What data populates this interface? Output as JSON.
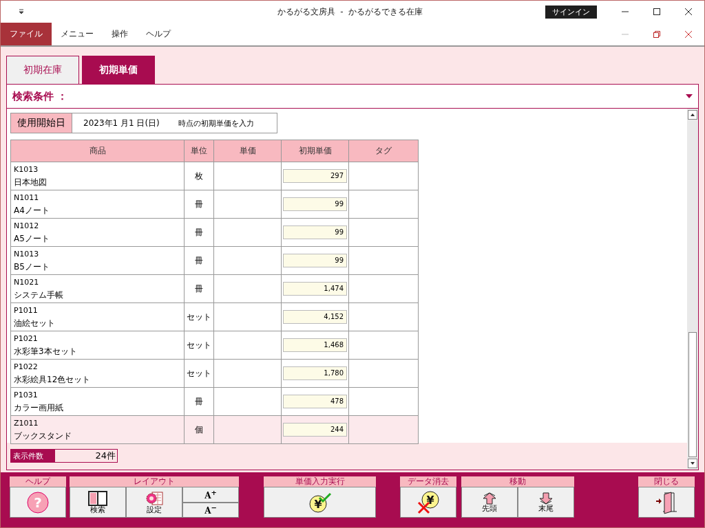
{
  "window": {
    "title": "かるがる文房具  -  かるがるできる在庫",
    "sign_in": "サインイン"
  },
  "menu": [
    {
      "label": "ファイル",
      "selected": true
    },
    {
      "label": "メニュー",
      "selected": false
    },
    {
      "label": "操作",
      "selected": false
    },
    {
      "label": "ヘルプ",
      "selected": false
    }
  ],
  "tabs": [
    {
      "label": "初期在庫",
      "selected": false
    },
    {
      "label": "初期単価",
      "selected": true
    }
  ],
  "search_conditions": {
    "label": "検索条件 ："
  },
  "start_date": {
    "label": "使用開始日",
    "value": "2023年1 月1 日(日)",
    "note": "時点の初期単価を入力"
  },
  "table": {
    "columns": [
      "商品",
      "単位",
      "単価",
      "初期単価",
      "タグ"
    ],
    "rows": [
      {
        "code": "K1013",
        "name": "日本地図",
        "unit": "枚",
        "initial_price": "297",
        "selected": false
      },
      {
        "code": "N1011",
        "name": "A4ノート",
        "unit": "冊",
        "initial_price": "99",
        "selected": false
      },
      {
        "code": "N1012",
        "name": "A5ノート",
        "unit": "冊",
        "initial_price": "99",
        "selected": false
      },
      {
        "code": "N1013",
        "name": "B5ノート",
        "unit": "冊",
        "initial_price": "99",
        "selected": false
      },
      {
        "code": "N1021",
        "name": "システム手帳",
        "unit": "冊",
        "initial_price": "1,474",
        "selected": false
      },
      {
        "code": "P1011",
        "name": "油絵セット",
        "unit": "セット",
        "initial_price": "4,152",
        "selected": false
      },
      {
        "code": "P1021",
        "name": "水彩筆3本セット",
        "unit": "セット",
        "initial_price": "1,468",
        "selected": false
      },
      {
        "code": "P1022",
        "name": "水彩絵具12色セット",
        "unit": "セット",
        "initial_price": "1,780",
        "selected": false
      },
      {
        "code": "P1031",
        "name": "カラー画用紙",
        "unit": "冊",
        "initial_price": "478",
        "selected": false
      },
      {
        "code": "Z1011",
        "name": "ブックスタンド",
        "unit": "個",
        "initial_price": "244",
        "selected": true
      }
    ]
  },
  "record_count": {
    "label": "表示件数",
    "value": "24件"
  },
  "toolbar": [
    {
      "label": "ヘルプ",
      "buttons": [
        {
          "kind": "help",
          "glyph": "?"
        }
      ]
    },
    {
      "label": "レイアウト",
      "buttons": [
        {
          "kind": "search",
          "label": "検索"
        },
        {
          "kind": "settings",
          "label": "設定"
        },
        {
          "kind": "font",
          "sizes": [
            "A$^{+}$",
            "A$^{−}$"
          ]
        }
      ]
    },
    {
      "label": "単価入力実行",
      "buttons": [
        {
          "kind": "execute",
          "glyph": "¥"
        }
      ]
    },
    {
      "label": "データ消去",
      "buttons": [
        {
          "kind": "clear",
          "glyph": "¥"
        }
      ]
    },
    {
      "label": "移動",
      "buttons": [
        {
          "kind": "first",
          "label": "先頭"
        },
        {
          "kind": "last",
          "label": "末尾"
        }
      ]
    },
    {
      "label": "閉じる",
      "buttons": [
        {
          "kind": "close"
        }
      ]
    }
  ]
}
